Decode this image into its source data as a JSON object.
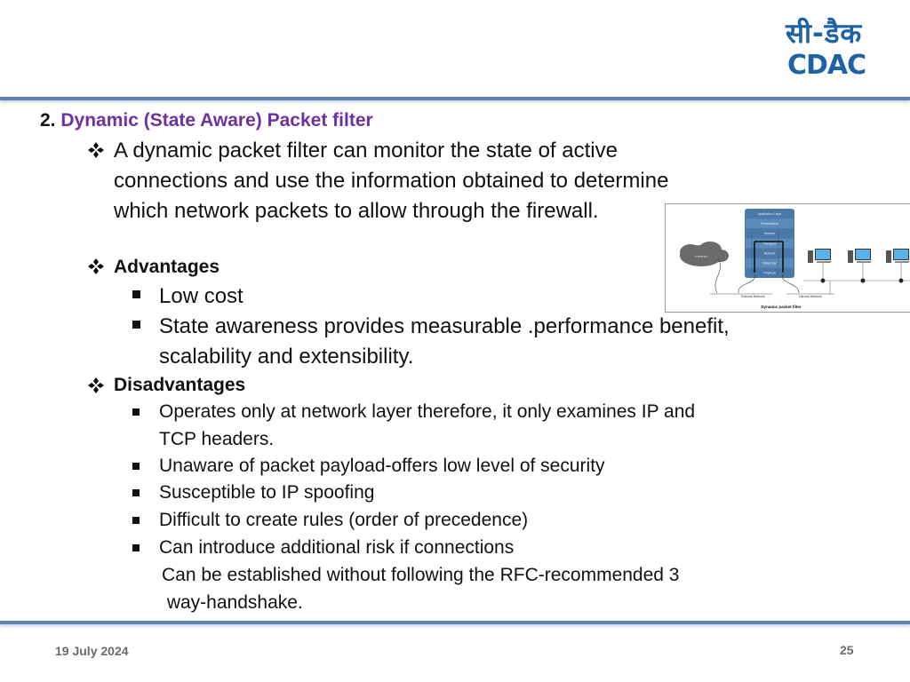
{
  "logo": {
    "hindi": "सी-डैक",
    "latin": "CDAC"
  },
  "heading": {
    "number": "2.",
    "title": "Dynamic (State Aware) Packet filter"
  },
  "intro": {
    "lines": [
      "A dynamic packet filter can monitor the state of active",
      "connections and use the information obtained to determine",
      "which network packets to allow through the firewall."
    ]
  },
  "advantages": {
    "label": "Advantages",
    "items": [
      {
        "lines": [
          "Low cost"
        ]
      },
      {
        "lines": [
          "State awareness provides measurable .performance benefit,",
          "scalability and extensibility."
        ]
      }
    ]
  },
  "disadvantages": {
    "label": "Disadvantages",
    "items": [
      {
        "lines": [
          "Operates only at network layer therefore, it only examines IP and",
          "TCP headers."
        ]
      },
      {
        "lines": [
          "Unaware of packet payload-offers low level of security"
        ]
      },
      {
        "lines": [
          "Susceptible to IP spoofing"
        ]
      },
      {
        "lines": [
          "Difficult to create rules (order of precedence)"
        ]
      },
      {
        "lines": [
          "Can introduce additional risk if connections",
          "Can be established without following the RFC-recommended 3",
          " way-handshake."
        ]
      }
    ]
  },
  "figure": {
    "caption": "Dynamic packet filter",
    "layers": [
      "Application Layer",
      "Presentation",
      "Session",
      "Transport",
      "Network",
      "Data Link",
      "Physical"
    ],
    "cloud_label": "Internet",
    "external_label": "External Network",
    "internal_label": "Internal Network"
  },
  "footer": {
    "date": "19 July 2024",
    "page": "25"
  },
  "colors": {
    "accent_purple": "#7030a0",
    "rule_blue": "#5b82b3",
    "logo_blue": "#1e63a6"
  }
}
